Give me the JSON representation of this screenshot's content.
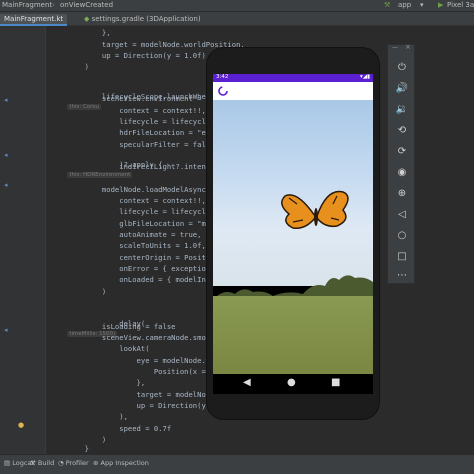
{
  "titlebar": {
    "breadcrumb1": "MainFragment",
    "breadcrumb2": "onViewCreated",
    "run_config": "app",
    "device": "Pixel 3a X"
  },
  "tabs": [
    {
      "label": "MainFragment.kt",
      "active": true
    },
    {
      "label": "settings.gradle (3DApplication)",
      "active": false
    }
  ],
  "code_lines": [
    {
      "text": "            },"
    },
    {
      "text": "            target = modelNode.worldPosition,"
    },
    {
      "text": "            up = Direction(y = 1.0f)"
    },
    {
      "text": "        )"
    },
    {
      "text": "        lifecycleScope.launchWhenCreated {",
      "hint": "this: Corou"
    },
    {
      "text": "            sceneView.environment = HDRLoader.loadE"
    },
    {
      "text": "                context = context!!,"
    },
    {
      "text": "                lifecycle = lifecycle,"
    },
    {
      "text": "                hdrFileLocation = \"environments/sel"
    },
    {
      "text": "                specularFilter = false"
    },
    {
      "text": "            )?.apply {",
      "hint": "this: HDREnvironment"
    },
    {
      "text": "                indirectLight?.intensity = 50_000f"
    },
    {
      "text": ""
    },
    {
      "text": "            modelNode.loadModelAsync("
    },
    {
      "text": "                context = context!!,"
    },
    {
      "text": "                lifecycle = lifecycle,"
    },
    {
      "text": "                glbFileLocation = \"models/fluttering"
    },
    {
      "text": "                autoAnimate = true,"
    },
    {
      "text": "                scaleToUnits = 1.0f,"
    },
    {
      "text": "                centerOrigin = Position(x = 0.0f, y"
    },
    {
      "text": "                onError = { exception -> },"
    },
    {
      "text": "                onLoaded = { modelInstance -> }"
    },
    {
      "text": "            )"
    },
    {
      "text": ""
    },
    {
      "text": ""
    },
    {
      "text": ""
    },
    {
      "text": "            delay(",
      "hint": "timeMillis: 1500)"
    },
    {
      "text": "            isLoading = false"
    },
    {
      "text": "            sceneView.cameraNode.smooth("
    },
    {
      "text": "                lookAt("
    },
    {
      "text": "                    eye = modelNode.worldPosition.l"
    },
    {
      "text": "                        Position(x = it.x - 0.4f, y"
    },
    {
      "text": "                    },"
    },
    {
      "text": "                    target = modelNode.worldPosition"
    },
    {
      "text": "                    up = Direction(y = 1.0f)"
    },
    {
      "text": "                ),"
    },
    {
      "text": "                speed = 0.7f"
    },
    {
      "text": "            )"
    },
    {
      "text": "        }"
    },
    {
      "text": "    }"
    }
  ],
  "phone": {
    "time": "3:42",
    "status_icons": "▾◢▮"
  },
  "statusbar": {
    "items": [
      "Logcat",
      "Build",
      "Profiler",
      "App Inspection"
    ]
  },
  "colors": {
    "ide_bg": "#2b2b2b",
    "app_bar_purple": "#5a1fd0",
    "butterfly_orange": "#e8901e"
  },
  "emulator_tools": [
    "power-icon",
    "volume-up-icon",
    "volume-down-icon",
    "rotate-left-icon",
    "rotate-right-icon",
    "camera-icon",
    "zoom-icon",
    "back-icon",
    "home-icon",
    "overview-icon",
    "more-icon"
  ]
}
